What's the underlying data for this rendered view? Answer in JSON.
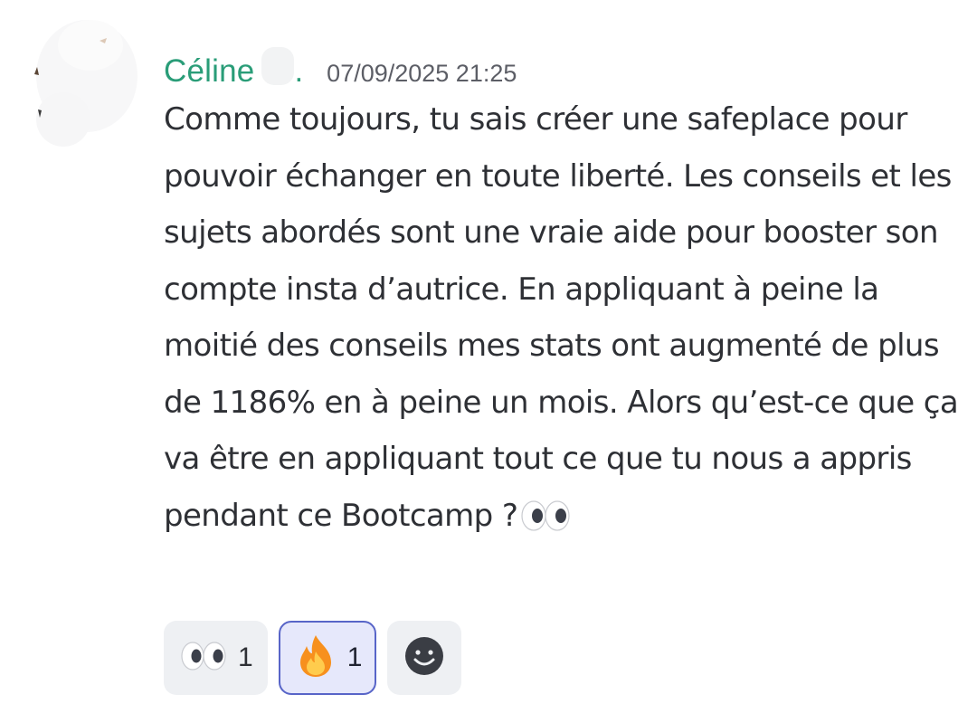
{
  "message": {
    "username": "Céline",
    "username_suffix": ".",
    "timestamp": "07/09/2025 21:25",
    "text": "Comme toujours, tu sais créer une safeplace pour pouvoir échanger en toute liberté. Les conseils et les sujets abordés sont une vraie aide pour booster son compte insta d’autrice. En appliquant à peine la moitié des conseils mes stats ont augmenté de plus de 1186% en à peine un mois. Alors qu’est-ce que ça va être en appliquant tout ce que tu nous a appris pendant ce Bootcamp ?",
    "trailing_emoji": "eyes"
  },
  "reactions": [
    {
      "emoji": "eyes",
      "count": "1",
      "active": false
    },
    {
      "emoji": "fire",
      "count": "1",
      "active": true
    }
  ],
  "add_reaction": {
    "icon": "smiley-add-reaction-icon"
  },
  "colors": {
    "username": "#2a9d78",
    "timestamp": "#5c5e66",
    "text": "#2e3035",
    "reaction_bg": "#eef0f3",
    "reaction_active_bg": "#e6e8fb",
    "reaction_active_border": "#5865c8"
  }
}
